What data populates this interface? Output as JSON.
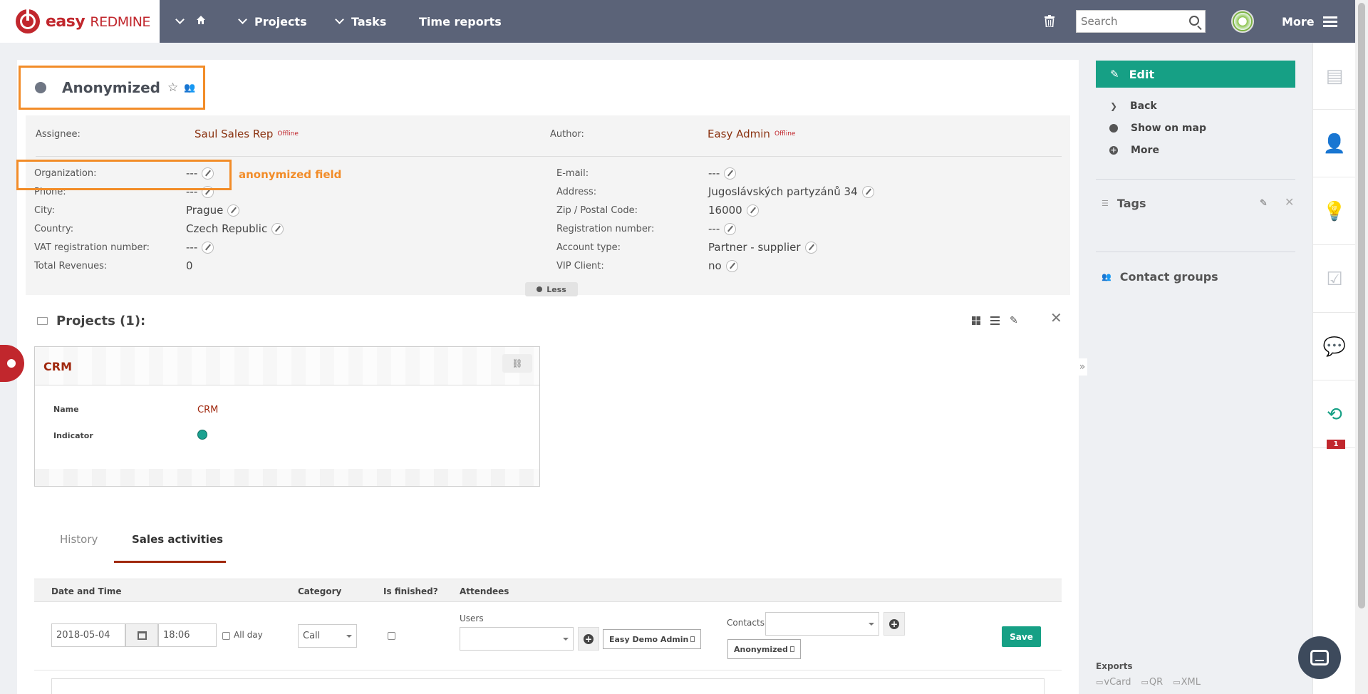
{
  "topbar": {
    "logo_easy": "easy",
    "logo_redmine": "REDMINE",
    "nav_projects": "Projects",
    "nav_tasks": "Tasks",
    "nav_time_reports": "Time reports",
    "search_placeholder": "Search",
    "more_label": "More"
  },
  "entity": {
    "title": "Anonymized"
  },
  "details": {
    "assignee_label": "Assignee:",
    "assignee_value": "Saul Sales Rep",
    "assignee_status": "Offline",
    "author_label": "Author:",
    "author_value": "Easy Admin",
    "author_status": "Offline",
    "left": [
      {
        "label": "Organization:",
        "value": "---"
      },
      {
        "label": "Phone:",
        "value": "---"
      },
      {
        "label": "City:",
        "value": "Prague"
      },
      {
        "label": "Country:",
        "value": "Czech Republic"
      },
      {
        "label": "VAT registration number:",
        "value": "---"
      },
      {
        "label": "Total Revenues:",
        "value": "0"
      }
    ],
    "right": [
      {
        "label": "E-mail:",
        "value": "---"
      },
      {
        "label": "Address:",
        "value": "Jugoslávských partyzánů 34"
      },
      {
        "label": "Zip / Postal Code:",
        "value": "16000"
      },
      {
        "label": "Registration number:",
        "value": "---"
      },
      {
        "label": "Account type:",
        "value": "Partner - supplier"
      },
      {
        "label": "VIP Client:",
        "value": "no"
      }
    ],
    "annotation": "anonymized field",
    "less_toggle": "Less"
  },
  "projects": {
    "title": "Projects (1):",
    "card": {
      "name": "CRM",
      "name_label": "Name",
      "name_value": "CRM",
      "indicator_label": "Indicator",
      "indicator_color": "#1aa190"
    }
  },
  "tabs": [
    {
      "label": "History",
      "active": false
    },
    {
      "label": "Sales activities",
      "active": true
    }
  ],
  "sales_activities": {
    "col_date_time": "Date and Time",
    "col_category": "Category",
    "col_finished": "Is finished?",
    "col_attendees": "Attendees",
    "date_value": "2018-05-04",
    "time_value": "18:06",
    "all_day_label": "All day",
    "category_value": "Call",
    "users_label": "Users",
    "user_chip": "Easy Demo Admin",
    "contacts_label": "Contacts",
    "contact_chip": "Anonymized",
    "save_label": "Save"
  },
  "sidebar": {
    "edit_label": "Edit",
    "back_label": "Back",
    "show_on_map_label": "Show on map",
    "more_label": "More",
    "tags_title": "Tags",
    "contact_groups_title": "Contact groups",
    "exports_title": "Exports",
    "export_vcard": "vCard",
    "export_qr": "QR",
    "export_xml": "XML"
  },
  "rail": {
    "history_badge": "1"
  },
  "colors": {
    "accent": "#16a085",
    "brand": "#c1272d",
    "topbar": "#5b6378",
    "highlight": "#f28c28",
    "link": "#8a3210"
  }
}
